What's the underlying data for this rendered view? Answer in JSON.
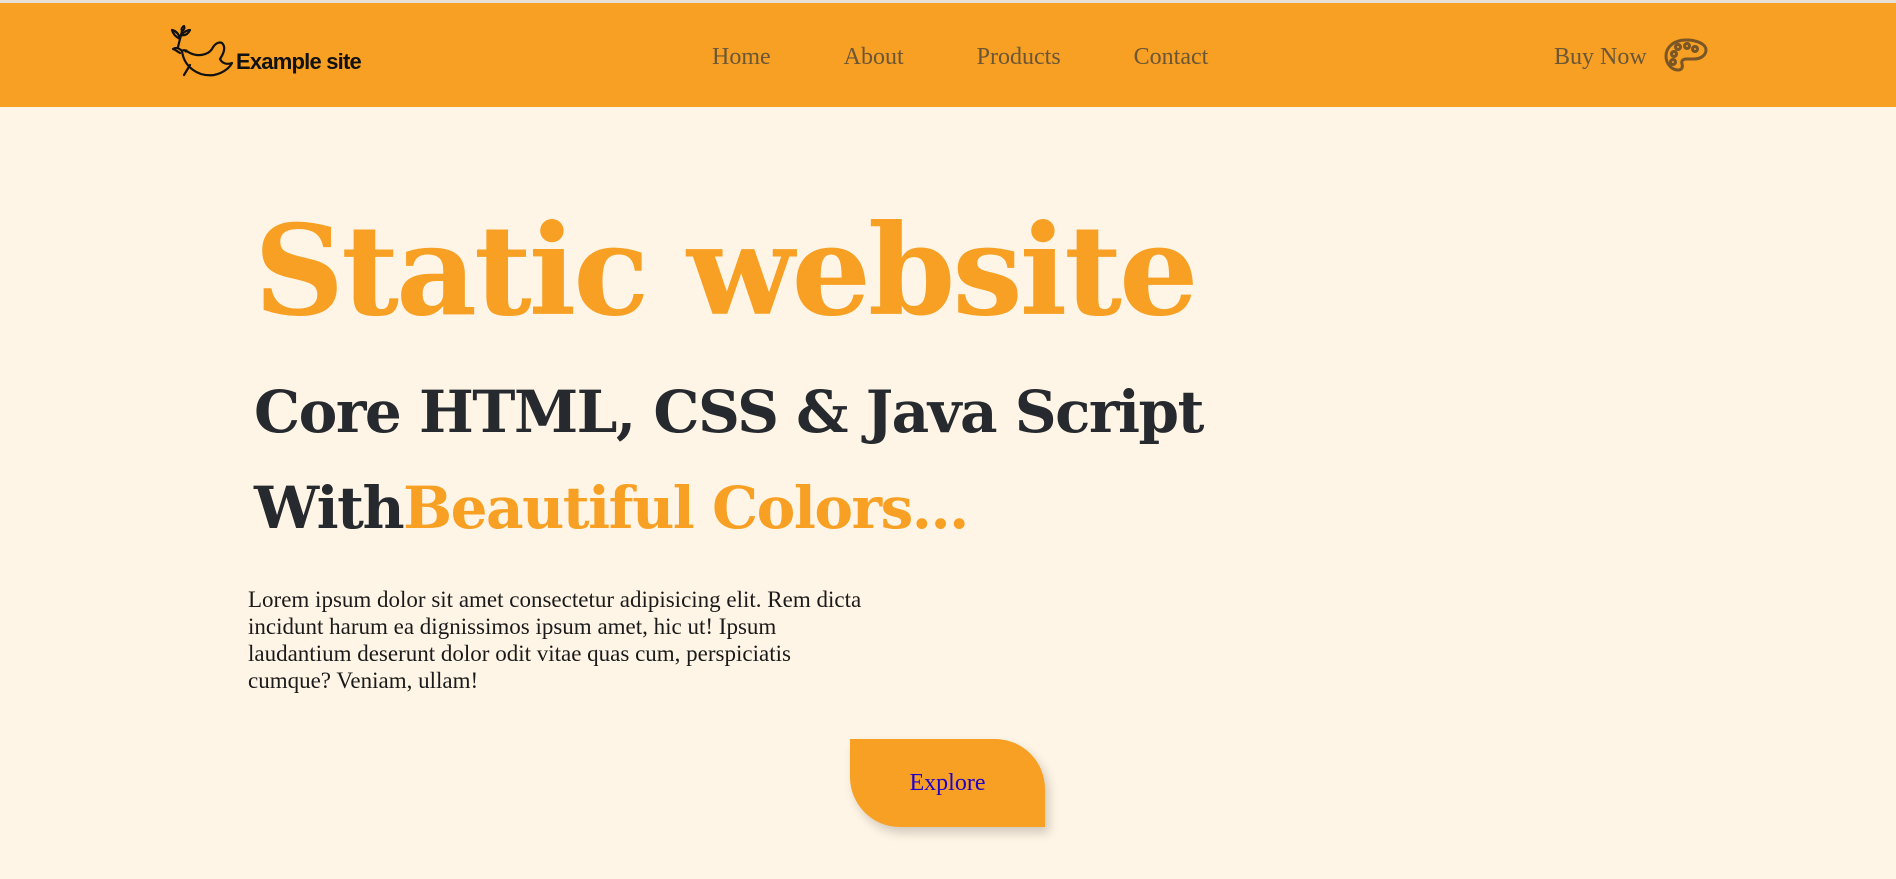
{
  "header": {
    "logo_text": "Example site",
    "nav": [
      "Home",
      "About",
      "Products",
      "Contact"
    ],
    "buy_now": "Buy Now"
  },
  "hero": {
    "title": "Static website",
    "subtitle": "Core HTML, CSS & Java Script",
    "with_word": "With",
    "with_colored": "Beautiful Colors...",
    "paragraph": "Lorem ipsum dolor sit amet consectetur adipisicing elit. Rem dicta incidunt harum ea dignissimos ipsum amet, hic ut! Ipsum laudantium deserunt dolor odit vitae quas cum, perspiciatis cumque? Veniam, ullam!",
    "cta": "Explore"
  },
  "icons": {
    "logo": "bird-icon",
    "theme": "palette-icon"
  },
  "colors": {
    "accent": "#f7a023",
    "background": "#fff5e6",
    "heading_dark": "#262a2e",
    "nav_text": "#6b5636",
    "link_blue": "#2200cc"
  }
}
